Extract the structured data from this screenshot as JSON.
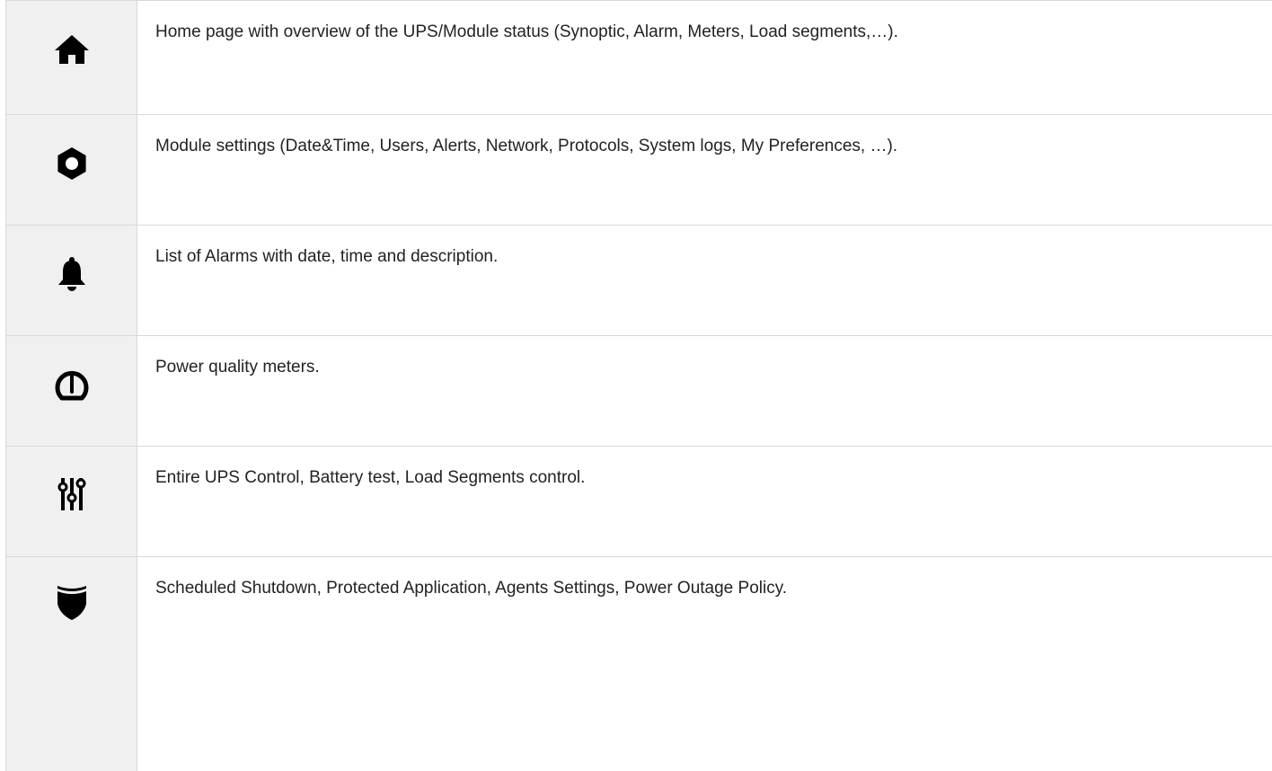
{
  "rows": [
    {
      "icon": "home-icon",
      "text": "Home page with overview of the UPS/Module status (Synoptic, Alarm, Meters, Load segments,…)."
    },
    {
      "icon": "gear-icon",
      "text": "Module settings (Date&Time, Users, Alerts, Network, Protocols, System logs, My Preferences, …)."
    },
    {
      "icon": "bell-icon",
      "text": "List of Alarms with date, time and description."
    },
    {
      "icon": "gauge-icon",
      "text": "Power quality meters."
    },
    {
      "icon": "sliders-icon",
      "text": "Entire UPS Control, Battery test, Load Segments control."
    },
    {
      "icon": "shield-icon",
      "text": "Scheduled Shutdown, Protected Application, Agents Settings, Power Outage Policy."
    }
  ],
  "colors": {
    "icon": "#000000",
    "icon_cell_bg": "#f0f0f0",
    "border": "#d9d9d9"
  }
}
